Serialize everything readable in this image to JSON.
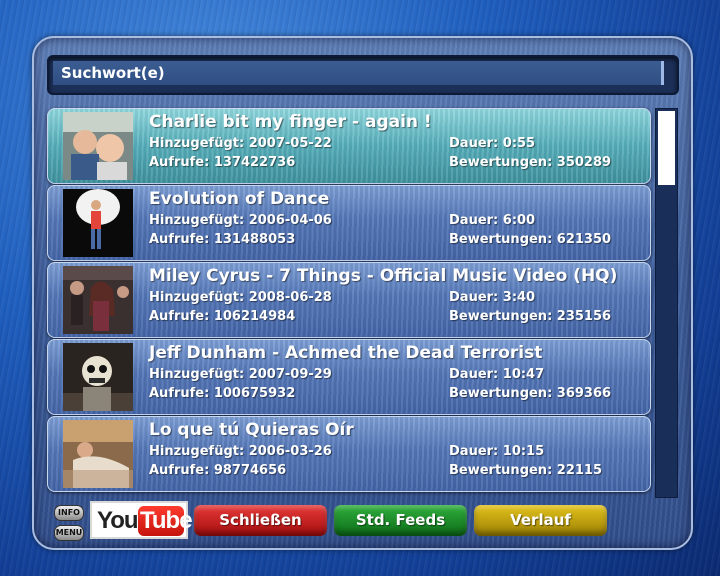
{
  "search": {
    "label": "Suchwort(e)"
  },
  "labels": {
    "added": "Hinzugefügt:",
    "views": "Aufrufe:",
    "duration": "Dauer:",
    "ratings": "Bewertungen:"
  },
  "videos": [
    {
      "title": "Charlie bit my finger - again !",
      "added_text": "Hinzugefügt: 2007-05-22",
      "views_text": "Aufrufe: 137422736",
      "duration_text": "Dauer: 0:55",
      "ratings_text": "Bewertungen: 350289",
      "selected": true
    },
    {
      "title": "Evolution of Dance",
      "added_text": "Hinzugefügt: 2006-04-06",
      "views_text": "Aufrufe: 131488053",
      "duration_text": "Dauer: 6:00",
      "ratings_text": "Bewertungen: 621350",
      "selected": false
    },
    {
      "title": "Miley Cyrus - 7 Things - Official Music Video (HQ)",
      "added_text": "Hinzugefügt: 2008-06-28",
      "views_text": "Aufrufe: 106214984",
      "duration_text": "Dauer: 3:40",
      "ratings_text": "Bewertungen: 235156",
      "selected": false
    },
    {
      "title": "Jeff Dunham - Achmed the Dead Terrorist",
      "added_text": "Hinzugefügt: 2007-09-29",
      "views_text": "Aufrufe: 100675932",
      "duration_text": "Dauer: 10:47",
      "ratings_text": "Bewertungen: 369366",
      "selected": false
    },
    {
      "title": "Lo que tú Quieras Oír",
      "added_text": "Hinzugefügt: 2006-03-26",
      "views_text": "Aufrufe: 98774656",
      "duration_text": "Dauer: 10:15",
      "ratings_text": "Bewertungen: 22115",
      "selected": false
    }
  ],
  "remote": {
    "info": "INFO",
    "menu": "MENU"
  },
  "logo": {
    "you": "You",
    "tube": "Tube"
  },
  "buttons": {
    "red": "Schließen",
    "green": "Std. Feeds",
    "yellow": "Verlauf"
  },
  "colors": {
    "red": "#c41e1e",
    "green": "#1a8a2a",
    "yellow": "#c9a810",
    "selected_row": "#5fb5c0"
  },
  "scrollbar": {
    "position_fraction": 0.0
  }
}
